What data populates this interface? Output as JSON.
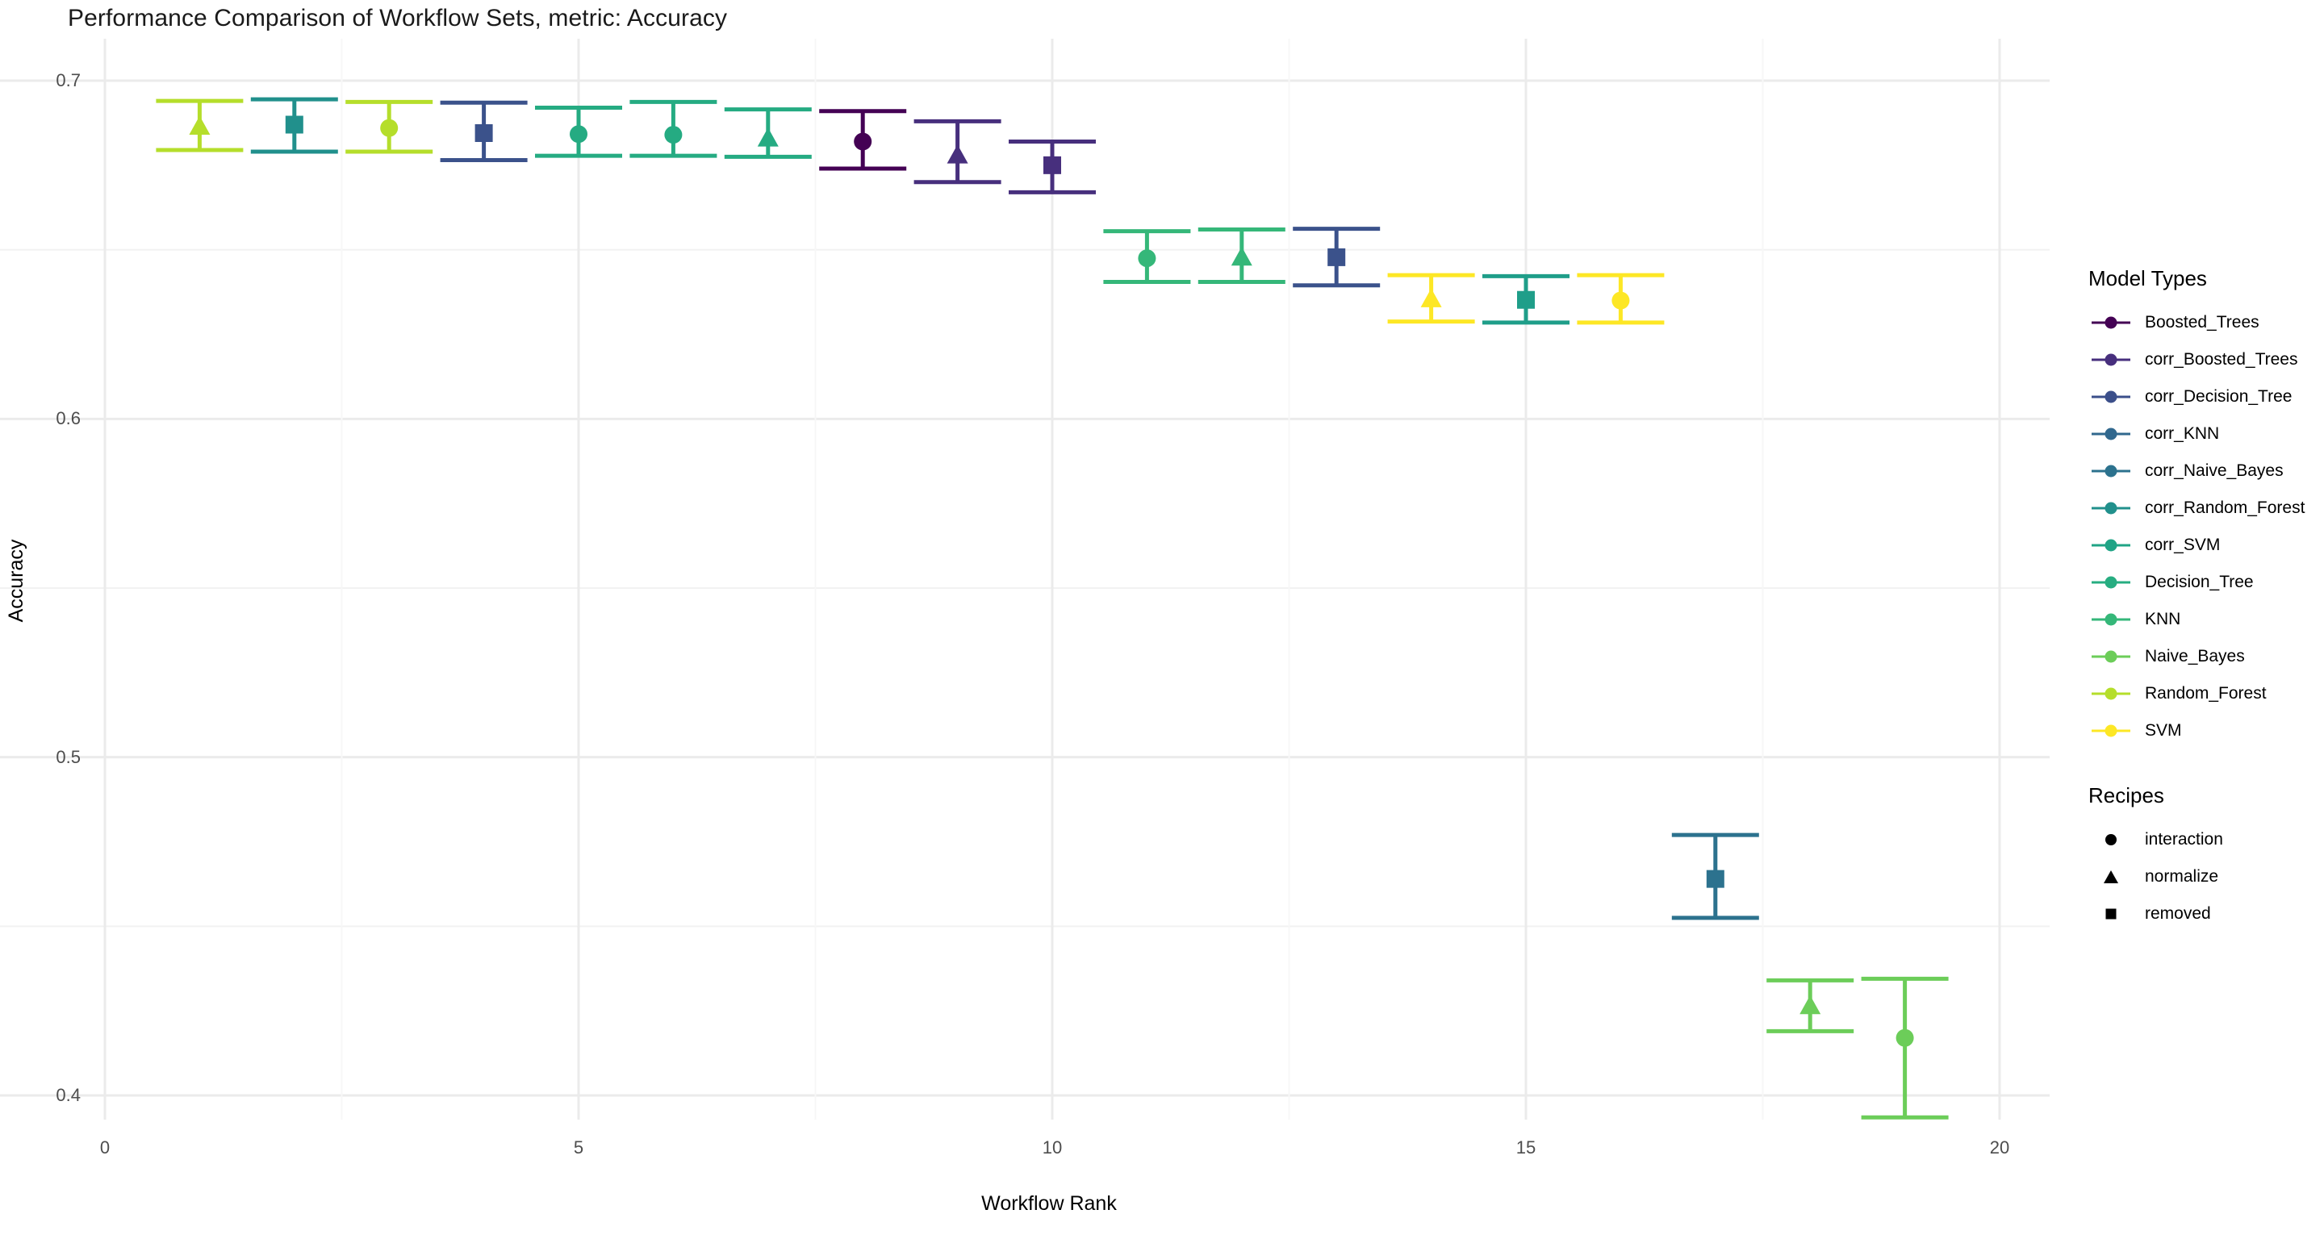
{
  "chart_data": {
    "type": "scatter",
    "title": "Performance Comparison of Workflow Sets, metric: Accuracy",
    "xlabel": "Workflow Rank",
    "ylabel": "Accuracy",
    "xlim": [
      -0.1,
      20.3
    ],
    "ylim": [
      0.382,
      0.706
    ],
    "xticks": [
      0,
      5,
      10,
      15,
      20
    ],
    "xtick_labels": [
      "0",
      "5",
      "10",
      "15",
      "20"
    ],
    "yticks": [
      0.4,
      0.5,
      0.6,
      0.7
    ],
    "ytick_labels": [
      "0.4",
      "0.5",
      "0.6",
      "0.7"
    ],
    "minor_yticks": [
      0.45,
      0.55,
      0.65
    ],
    "grid": true,
    "grid_color": "#EBEBEB",
    "background": "#FFFFFF",
    "error_bar_style": "mean with upper/lower confidence interval caps",
    "points": [
      {
        "rank": 1,
        "mean": 0.6865,
        "lower": 0.6795,
        "upper": 0.694,
        "model": "Random_Forest",
        "recipe": "normalize",
        "color": "#B5DE2B"
      },
      {
        "rank": 2,
        "mean": 0.687,
        "lower": 0.679,
        "upper": 0.6945,
        "model": "corr_Random_Forest",
        "recipe": "removed",
        "color": "#21908C"
      },
      {
        "rank": 3,
        "mean": 0.686,
        "lower": 0.679,
        "upper": 0.6937,
        "model": "Random_Forest",
        "recipe": "interaction",
        "color": "#B5DE2B"
      },
      {
        "rank": 4,
        "mean": 0.6845,
        "lower": 0.6765,
        "upper": 0.6935,
        "model": "corr_Decision_Tree",
        "recipe": "removed",
        "color": "#3B528B"
      },
      {
        "rank": 5,
        "mean": 0.6842,
        "lower": 0.6778,
        "upper": 0.692,
        "model": "corr_SVM",
        "recipe": "interaction",
        "color": "#25AB82"
      },
      {
        "rank": 6,
        "mean": 0.684,
        "lower": 0.6778,
        "upper": 0.6937,
        "model": "corr_SVM",
        "recipe": "interaction",
        "color": "#25AB82"
      },
      {
        "rank": 7,
        "mean": 0.683,
        "lower": 0.6775,
        "upper": 0.6915,
        "model": "corr_SVM",
        "recipe": "normalize",
        "color": "#25AB82"
      },
      {
        "rank": 8,
        "mean": 0.682,
        "lower": 0.674,
        "upper": 0.691,
        "model": "Boosted_Trees",
        "recipe": "interaction",
        "color": "#440154"
      },
      {
        "rank": 9,
        "mean": 0.678,
        "lower": 0.67,
        "upper": 0.688,
        "model": "corr_Boosted_Trees",
        "recipe": "normalize",
        "color": "#472F7D"
      },
      {
        "rank": 10,
        "mean": 0.675,
        "lower": 0.667,
        "upper": 0.682,
        "model": "corr_Boosted_Trees",
        "recipe": "removed",
        "color": "#472F7D"
      },
      {
        "rank": 11,
        "mean": 0.6475,
        "lower": 0.6405,
        "upper": 0.6555,
        "model": "Decision_Tree",
        "recipe": "interaction",
        "color": "#35B779"
      },
      {
        "rank": 12,
        "mean": 0.6478,
        "lower": 0.6405,
        "upper": 0.656,
        "model": "Decision_Tree",
        "recipe": "normalize",
        "color": "#35B779"
      },
      {
        "rank": 13,
        "mean": 0.6478,
        "lower": 0.6395,
        "upper": 0.6562,
        "model": "corr_KNN",
        "recipe": "removed",
        "color": "#3B528B"
      },
      {
        "rank": 14,
        "mean": 0.6355,
        "lower": 0.6288,
        "upper": 0.6425,
        "model": "SVM",
        "recipe": "normalize",
        "color": "#FDE725"
      },
      {
        "rank": 15,
        "mean": 0.6352,
        "lower": 0.6285,
        "upper": 0.6422,
        "model": "corr_SVM",
        "recipe": "removed",
        "color": "#1F9E89"
      },
      {
        "rank": 16,
        "mean": 0.635,
        "lower": 0.6285,
        "upper": 0.6425,
        "model": "SVM",
        "recipe": "interaction",
        "color": "#FDE725"
      },
      {
        "rank": 17,
        "mean": 0.464,
        "lower": 0.4525,
        "upper": 0.477,
        "model": "corr_Naive_Bayes",
        "recipe": "removed",
        "color": "#2C728E"
      },
      {
        "rank": 18,
        "mean": 0.4265,
        "lower": 0.419,
        "upper": 0.434,
        "model": "Naive_Bayes",
        "recipe": "normalize",
        "color": "#6CCD59"
      },
      {
        "rank": 19,
        "mean": 0.417,
        "lower": 0.3935,
        "upper": 0.4345,
        "model": "Naive_Bayes",
        "recipe": "interaction",
        "color": "#6CCD59"
      }
    ],
    "legends": [
      {
        "title": "Model Types",
        "key_type": "line-point",
        "entries": [
          {
            "label": "Boosted_Trees",
            "color": "#440154"
          },
          {
            "label": "corr_Boosted_Trees",
            "color": "#472F7D"
          },
          {
            "label": "corr_Decision_Tree",
            "color": "#3B4F8A"
          },
          {
            "label": "corr_KNN",
            "color": "#31688E"
          },
          {
            "label": "corr_Naive_Bayes",
            "color": "#2C728E"
          },
          {
            "label": "corr_Random_Forest",
            "color": "#21908C"
          },
          {
            "label": "corr_SVM",
            "color": "#20A486"
          },
          {
            "label": "Decision_Tree",
            "color": "#27AD81"
          },
          {
            "label": "KNN",
            "color": "#35B779"
          },
          {
            "label": "Naive_Bayes",
            "color": "#6CCD59"
          },
          {
            "label": "Random_Forest",
            "color": "#B5DE2B"
          },
          {
            "label": "SVM",
            "color": "#FDE725"
          }
        ]
      },
      {
        "title": "Recipes",
        "key_type": "shape",
        "entries": [
          {
            "label": "interaction",
            "shape": "circle"
          },
          {
            "label": "normalize",
            "shape": "triangle"
          },
          {
            "label": "removed",
            "shape": "square"
          }
        ]
      }
    ]
  }
}
